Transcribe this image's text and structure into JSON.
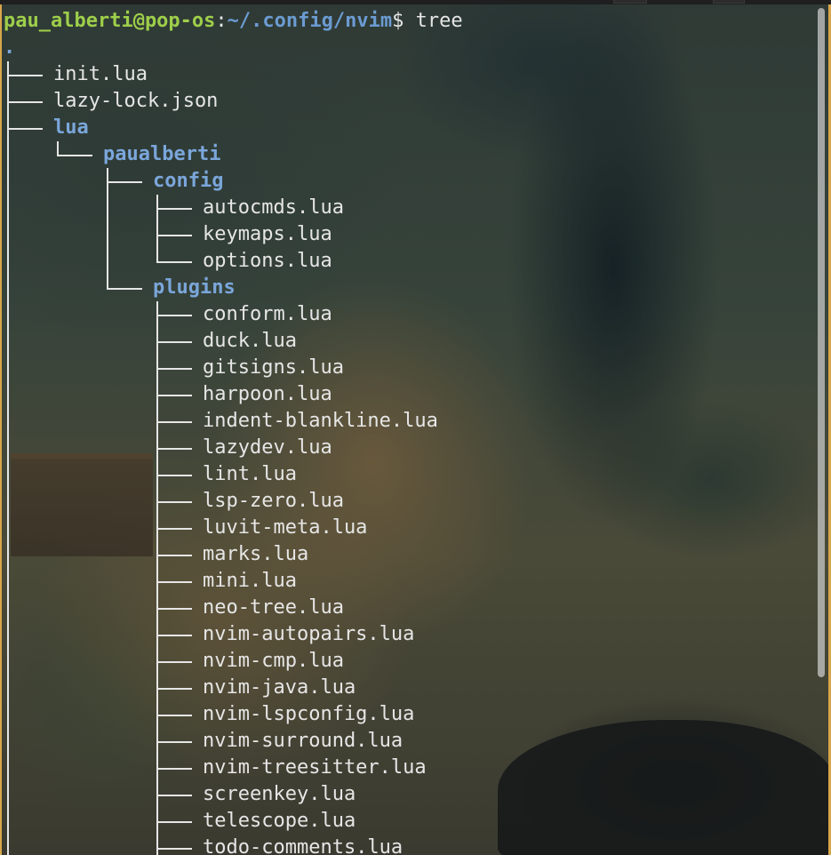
{
  "terminal": {
    "prompt": {
      "user_host": "pau_alberti@pop-os",
      "colon": ":",
      "path": "~/.config/nvim",
      "dollar": "$",
      "command": " tree"
    },
    "root": ".",
    "entries": [
      {
        "name": "init.lua",
        "depth": 0,
        "kind": "file",
        "last": false
      },
      {
        "name": "lazy-lock.json",
        "depth": 0,
        "kind": "file",
        "last": false
      },
      {
        "name": "lua",
        "depth": 0,
        "kind": "dir",
        "last": false
      },
      {
        "name": "paualberti",
        "depth": 1,
        "kind": "dir",
        "last": true
      },
      {
        "name": "config",
        "depth": 2,
        "kind": "dir",
        "last": false
      },
      {
        "name": "autocmds.lua",
        "depth": 3,
        "kind": "file",
        "last": false
      },
      {
        "name": "keymaps.lua",
        "depth": 3,
        "kind": "file",
        "last": false
      },
      {
        "name": "options.lua",
        "depth": 3,
        "kind": "file",
        "last": true
      },
      {
        "name": "plugins",
        "depth": 2,
        "kind": "dir",
        "last": true
      },
      {
        "name": "conform.lua",
        "depth": 3,
        "kind": "file",
        "last": false
      },
      {
        "name": "duck.lua",
        "depth": 3,
        "kind": "file",
        "last": false
      },
      {
        "name": "gitsigns.lua",
        "depth": 3,
        "kind": "file",
        "last": false
      },
      {
        "name": "harpoon.lua",
        "depth": 3,
        "kind": "file",
        "last": false
      },
      {
        "name": "indent-blankline.lua",
        "depth": 3,
        "kind": "file",
        "last": false
      },
      {
        "name": "lazydev.lua",
        "depth": 3,
        "kind": "file",
        "last": false
      },
      {
        "name": "lint.lua",
        "depth": 3,
        "kind": "file",
        "last": false
      },
      {
        "name": "lsp-zero.lua",
        "depth": 3,
        "kind": "file",
        "last": false
      },
      {
        "name": "luvit-meta.lua",
        "depth": 3,
        "kind": "file",
        "last": false
      },
      {
        "name": "marks.lua",
        "depth": 3,
        "kind": "file",
        "last": false
      },
      {
        "name": "mini.lua",
        "depth": 3,
        "kind": "file",
        "last": false
      },
      {
        "name": "neo-tree.lua",
        "depth": 3,
        "kind": "file",
        "last": false
      },
      {
        "name": "nvim-autopairs.lua",
        "depth": 3,
        "kind": "file",
        "last": false
      },
      {
        "name": "nvim-cmp.lua",
        "depth": 3,
        "kind": "file",
        "last": false
      },
      {
        "name": "nvim-java.lua",
        "depth": 3,
        "kind": "file",
        "last": false
      },
      {
        "name": "nvim-lspconfig.lua",
        "depth": 3,
        "kind": "file",
        "last": false
      },
      {
        "name": "nvim-surround.lua",
        "depth": 3,
        "kind": "file",
        "last": false
      },
      {
        "name": "nvim-treesitter.lua",
        "depth": 3,
        "kind": "file",
        "last": false
      },
      {
        "name": "screenkey.lua",
        "depth": 3,
        "kind": "file",
        "last": false
      },
      {
        "name": "telescope.lua",
        "depth": 3,
        "kind": "file",
        "last": false
      },
      {
        "name": "todo-comments.lua",
        "depth": 3,
        "kind": "file",
        "last": false
      }
    ]
  },
  "scrollbar": {
    "position": 0.0,
    "visible_fraction": 0.79
  },
  "colors": {
    "prompt_user": "#9ece4a",
    "prompt_path": "#6b9bd1",
    "directory": "#7aa6da",
    "text": "#e6e6e6",
    "window_border": "#d8a64a"
  }
}
